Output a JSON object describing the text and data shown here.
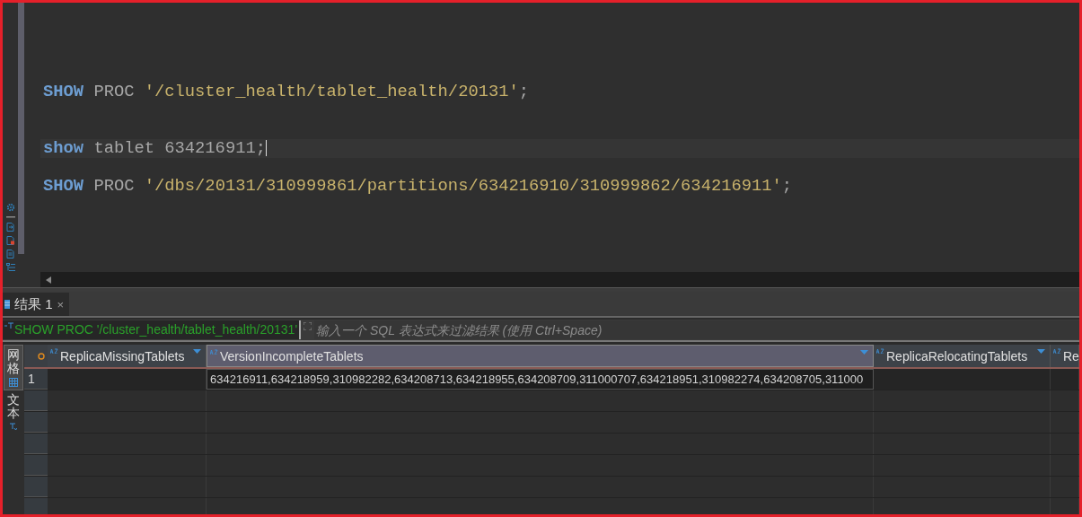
{
  "editor": {
    "lines": [
      {
        "kind": "blank"
      },
      {
        "kind": "blank"
      },
      {
        "kind": "blank"
      },
      {
        "kind": "blank"
      },
      {
        "kind": "code",
        "current": false,
        "tokens": [
          {
            "kind": "keyword",
            "text": "SHOW"
          },
          {
            "kind": "plain",
            "text": "PROC"
          },
          {
            "kind": "string",
            "text": "'/cluster_health/tablet_health/20131'"
          },
          {
            "kind": "punct",
            "text": ";"
          }
        ]
      },
      {
        "kind": "blank"
      },
      {
        "kind": "blank"
      },
      {
        "kind": "code",
        "current": true,
        "tokens": [
          {
            "kind": "keyword",
            "text": "show"
          },
          {
            "kind": "plain",
            "text": "tablet 634216911"
          },
          {
            "kind": "punct",
            "text": ";"
          }
        ]
      },
      {
        "kind": "blank"
      },
      {
        "kind": "code",
        "current": false,
        "tokens": [
          {
            "kind": "keyword",
            "text": "SHOW"
          },
          {
            "kind": "plain",
            "text": "PROC"
          },
          {
            "kind": "string",
            "text": "'/dbs/20131/310999861/partitions/634216910/310999862/634216911'"
          },
          {
            "kind": "punct",
            "text": ";"
          }
        ]
      }
    ]
  },
  "results": {
    "tabs": [
      {
        "label": "结果 1",
        "selected": true,
        "close": "×"
      }
    ],
    "query": "SHOW PROC '/cluster_health/tablet_health/20131'",
    "filter": {
      "placeholder": "输入一个 SQL 表达式来过滤结果 (使用 Ctrl+Space)"
    },
    "side_tabs": [
      {
        "label": "网格",
        "selected": true
      },
      {
        "label": "文本",
        "selected": false
      }
    ],
    "columns": [
      {
        "name": "ReplicaMissingTablets",
        "selected": false
      },
      {
        "name": "VersionIncompleteTablets",
        "selected": true
      },
      {
        "name": "ReplicaRelocatingTablets",
        "selected": false
      },
      {
        "name": "Re",
        "selected": false
      }
    ],
    "rows": [
      {
        "number": "1",
        "values": {
          "column_2": "634216911,634218959,310982282,634208713,634218955,634208709,311000707,634218951,310982274,634208705,311000"
        }
      }
    ]
  }
}
